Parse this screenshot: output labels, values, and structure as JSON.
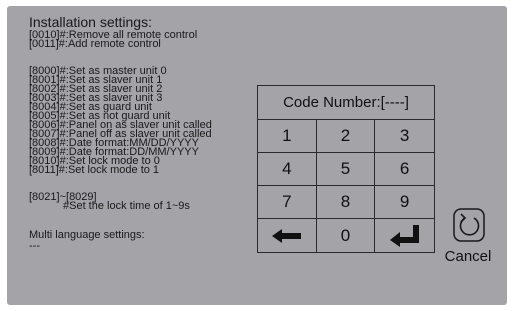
{
  "install": {
    "title": "Installation settings:",
    "lines_a": [
      "[0010]#:Remove all remote control",
      "[0011]#:Add remote control"
    ],
    "lines_b": [
      "[8000]#:Set as master unit 0",
      "[8001]#:Set as slaver unit 1",
      "[8002]#:Set as slaver unit 2",
      "[8003]#:Set as slaver unit 3",
      "[8004]#:Set as guard unit",
      "[8005]#:Set as not guard unit",
      "[8006]#:Panel on as slaver unit called",
      "[8007]#:Panel off as slaver unit called",
      "[8008]#:Date format:MM/DD/YYYY",
      "[8009]#:Date format:DD/MM/YYYY",
      "[8010]#:Set lock mode to 0",
      "[8011]#:Set lock mode to 1"
    ],
    "lock_range": "[8021]~[8029]",
    "lock_desc": "#Set the lock time of 1~9s",
    "multi_title": "Multi language settings:",
    "multi_value": "---"
  },
  "keypad": {
    "code_label": "Code Number:[----]",
    "keys": [
      "1",
      "2",
      "3",
      "4",
      "5",
      "6",
      "7",
      "8",
      "9",
      "backspace",
      "0",
      "enter"
    ]
  },
  "cancel": {
    "label": "Cancel",
    "icon": "undo-icon"
  },
  "colors": {
    "screen_bg": "#a3a3a8",
    "text": "#1a1a1a"
  }
}
